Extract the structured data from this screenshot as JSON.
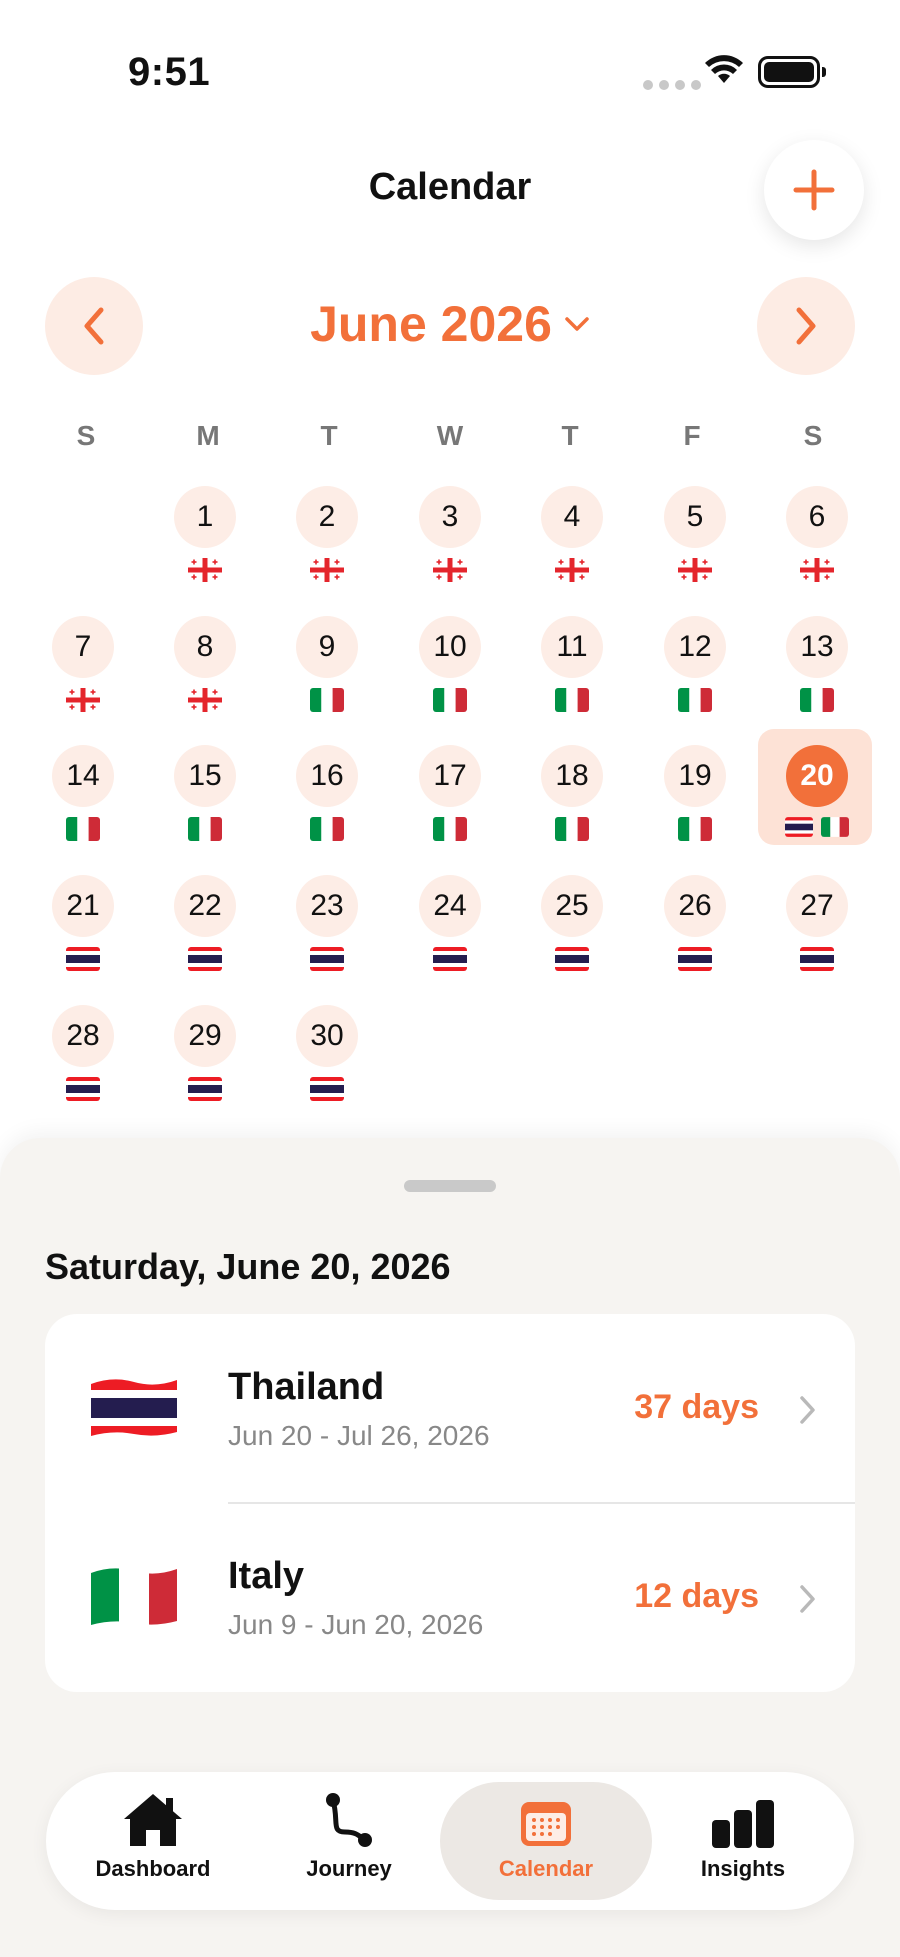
{
  "status_bar": {
    "time": "9:51"
  },
  "header": {
    "title": "Calendar"
  },
  "month_nav": {
    "label": "June 2026"
  },
  "weekdays": [
    "S",
    "M",
    "T",
    "W",
    "T",
    "F",
    "S"
  ],
  "flags": {
    "georgia": {
      "name": "Georgia",
      "colors": [
        "#ffffff",
        "#e4252c"
      ]
    },
    "italy": {
      "name": "Italy",
      "colors": [
        "#009246",
        "#ffffff",
        "#ce2b37"
      ]
    },
    "thailand": {
      "name": "Thailand",
      "colors": [
        "#ed1c24",
        "#ffffff",
        "#241d4f"
      ]
    }
  },
  "calendar": {
    "days": [
      {
        "d": "1",
        "f": [
          "georgia"
        ]
      },
      {
        "d": "2",
        "f": [
          "georgia"
        ]
      },
      {
        "d": "3",
        "f": [
          "georgia"
        ]
      },
      {
        "d": "4",
        "f": [
          "georgia"
        ]
      },
      {
        "d": "5",
        "f": [
          "georgia"
        ]
      },
      {
        "d": "6",
        "f": [
          "georgia"
        ]
      },
      {
        "d": "7",
        "f": [
          "georgia"
        ]
      },
      {
        "d": "8",
        "f": [
          "georgia"
        ]
      },
      {
        "d": "9",
        "f": [
          "italy"
        ]
      },
      {
        "d": "10",
        "f": [
          "italy"
        ]
      },
      {
        "d": "11",
        "f": [
          "italy"
        ]
      },
      {
        "d": "12",
        "f": [
          "italy"
        ]
      },
      {
        "d": "13",
        "f": [
          "italy"
        ]
      },
      {
        "d": "14",
        "f": [
          "italy"
        ]
      },
      {
        "d": "15",
        "f": [
          "italy"
        ]
      },
      {
        "d": "16",
        "f": [
          "italy"
        ]
      },
      {
        "d": "17",
        "f": [
          "italy"
        ]
      },
      {
        "d": "18",
        "f": [
          "italy"
        ]
      },
      {
        "d": "19",
        "f": [
          "italy"
        ]
      },
      {
        "d": "20",
        "f": [
          "thailand",
          "italy"
        ],
        "selected": true
      },
      {
        "d": "21",
        "f": [
          "thailand"
        ]
      },
      {
        "d": "22",
        "f": [
          "thailand"
        ]
      },
      {
        "d": "23",
        "f": [
          "thailand"
        ]
      },
      {
        "d": "24",
        "f": [
          "thailand"
        ]
      },
      {
        "d": "25",
        "f": [
          "thailand"
        ]
      },
      {
        "d": "26",
        "f": [
          "thailand"
        ]
      },
      {
        "d": "27",
        "f": [
          "thailand"
        ]
      },
      {
        "d": "28",
        "f": [
          "thailand"
        ]
      },
      {
        "d": "29",
        "f": [
          "thailand"
        ]
      },
      {
        "d": "30",
        "f": [
          "thailand"
        ]
      }
    ]
  },
  "sheet": {
    "selected_date": "Saturday, June 20, 2026",
    "trips": [
      {
        "country": "Thailand",
        "dates": "Jun 20 - Jul 26, 2026",
        "days": "37 days",
        "flag": "thailand"
      },
      {
        "country": "Italy",
        "dates": "Jun 9 - Jun 20, 2026",
        "days": "12 days",
        "flag": "italy"
      }
    ]
  },
  "tabs": [
    {
      "label": "Dashboard",
      "icon": "house-icon"
    },
    {
      "label": "Journey",
      "icon": "route-icon"
    },
    {
      "label": "Calendar",
      "icon": "calendar-icon",
      "active": true
    },
    {
      "label": "Insights",
      "icon": "bar-chart-icon"
    }
  ],
  "colors": {
    "accent": "#f2703a",
    "accent_soft": "#fdede6",
    "sheet_bg": "#f6f4f1"
  }
}
